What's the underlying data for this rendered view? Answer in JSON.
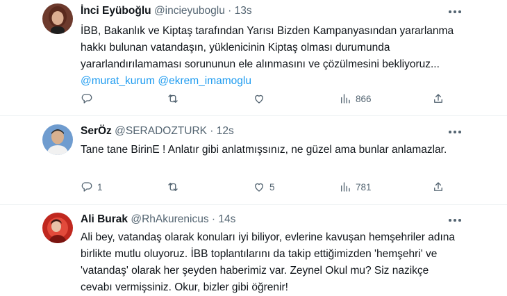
{
  "tweets": [
    {
      "name": "İnci Eyüboğlu",
      "handle": "@incieyuboglu",
      "dot": "·",
      "time": "13s",
      "text": "İBB, Bakanlık ve Kiptaş tarafından Yarısı Bizden Kampanyasından yararlanma hakkı bulunan vatandaşın, yüklenicinin Kiptaş olması durumunda yararlandırılamaması sorununun ele alınmasını ve çözülmesini bekliyoruz... ",
      "mentions": [
        "@murat_kurum",
        "@ekrem_imamoglu"
      ],
      "reply_count": "",
      "retweet_count": "",
      "like_count": "",
      "view_count": "866",
      "avatar_colors": {
        "bg": "#7a3b2e",
        "face": "#d9a58a",
        "hair": "#5a2a1e"
      }
    },
    {
      "name": "SerÖz",
      "handle": "@SERADOZTURK",
      "dot": "·",
      "time": "12s",
      "text": "Tane tane BirinE  ! Anlatır gibi  anlatmışsınız, ne güzel ama bunlar anlamazlar.",
      "reply_count": "1",
      "retweet_count": "",
      "like_count": "5",
      "view_count": "781",
      "avatar_colors": {
        "bg": "#3f6ea8",
        "face": "#d7b08f",
        "hair": "#2a2a2a"
      }
    },
    {
      "name": "Ali Burak",
      "handle": "@RhAkurenicus",
      "dot": "·",
      "time": "14s",
      "text": "Ali bey, vatandaş olarak konuları iyi biliyor, evlerine kavuşan hemşehriler adına birlikte mutlu oluyoruz. İBB toplantılarını da takip ettiğimizden 'hemşehri' ve 'vatandaş' olarak her şeyden haberimiz var. Zeynel Okul mu? Siz nazikçe cevabı vermişsiniz. Okur, bizler gibi öğrenir!",
      "avatar_colors": {
        "bg": "#b3261e",
        "face": "#e8c2a8",
        "hair": "#3a1a14"
      }
    }
  ]
}
